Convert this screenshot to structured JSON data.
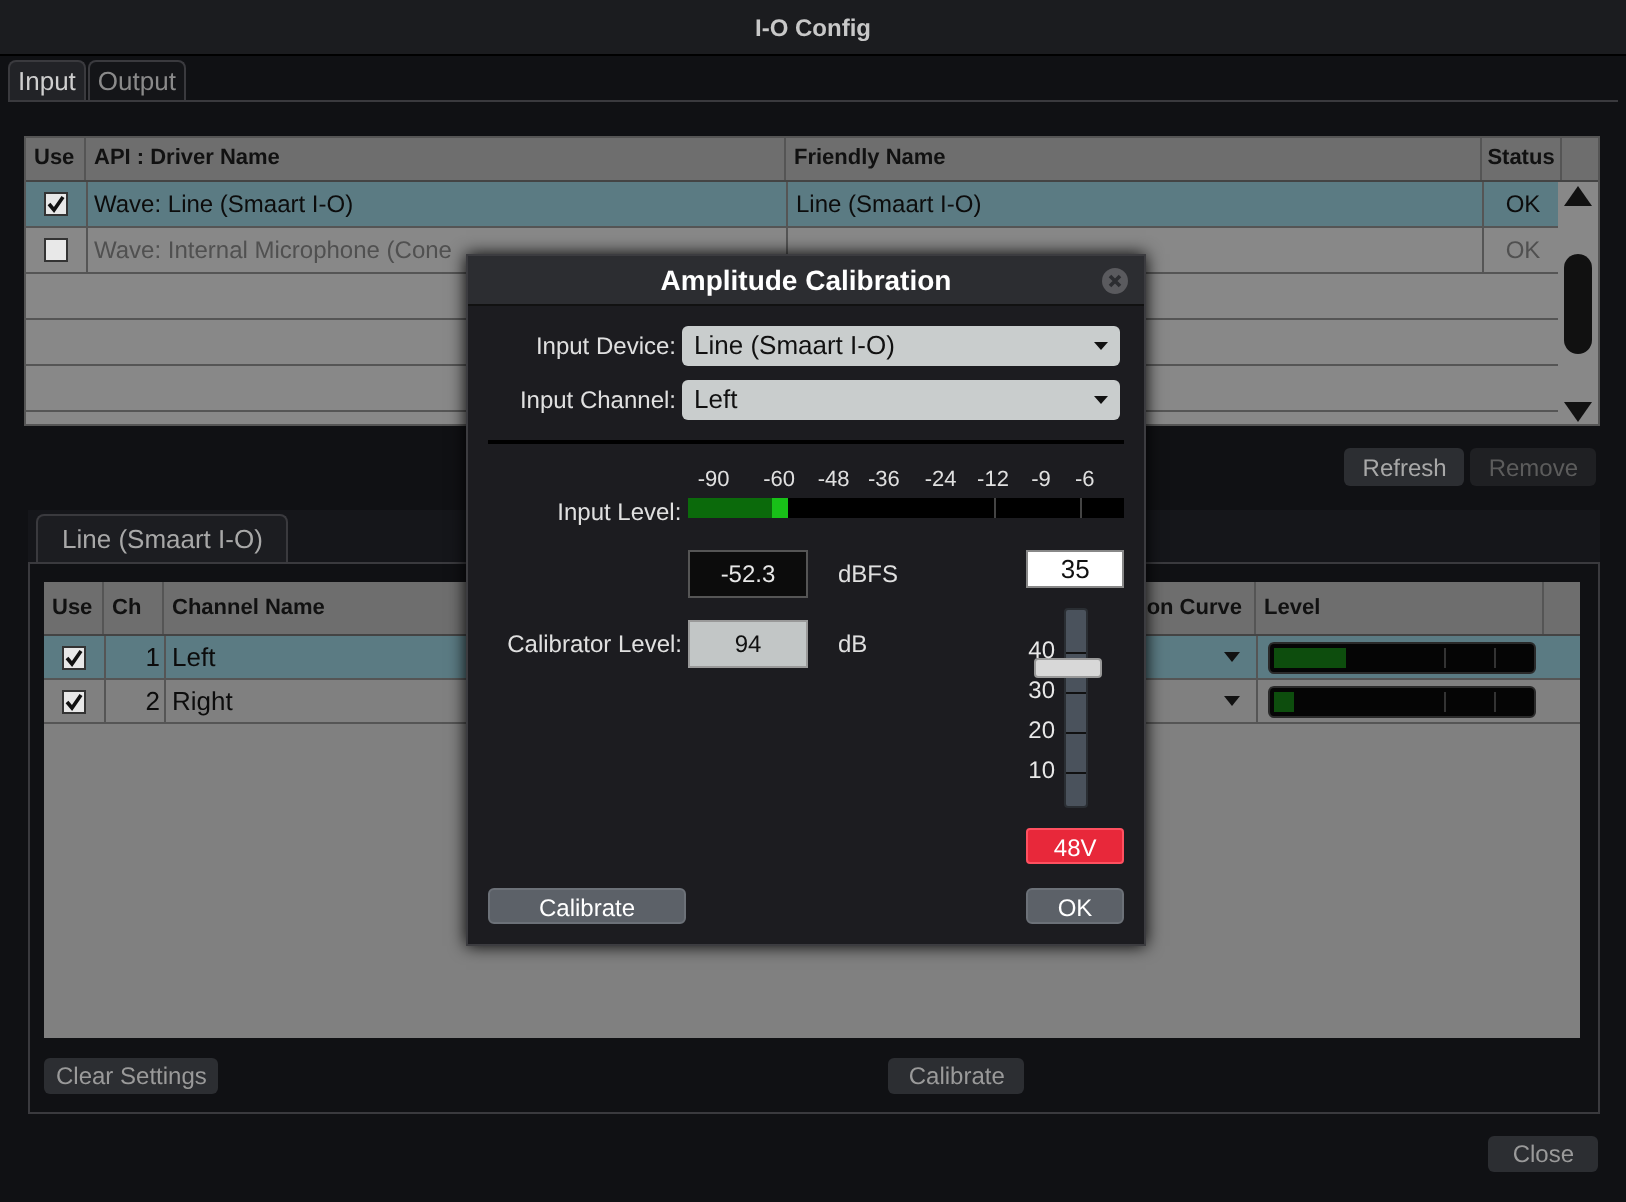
{
  "window": {
    "title": "I-O Config"
  },
  "tabs": [
    {
      "label": "Input",
      "selected": true
    },
    {
      "label": "Output",
      "selected": false
    }
  ],
  "devices": {
    "columns": [
      "Use",
      "API : Driver Name",
      "Friendly Name",
      "Status"
    ],
    "rows": [
      {
        "checked": true,
        "selected": true,
        "disabled": false,
        "driver": "Wave: Line (Smaart I-O)",
        "friendly": "Line (Smaart I-O)",
        "status": "OK"
      },
      {
        "checked": false,
        "selected": false,
        "disabled": true,
        "driver": "Wave: Internal Microphone (Cone",
        "status": "OK"
      }
    ]
  },
  "device_buttons": [
    {
      "label": "Refresh",
      "disabled": false
    },
    {
      "label": "Remove",
      "disabled": true
    }
  ],
  "device_tab": {
    "label": "Line (Smaart I-O)"
  },
  "channels": {
    "columns": [
      "Use",
      "Ch",
      "Channel Name",
      "on Curve",
      "Level"
    ],
    "rows": [
      {
        "checked": true,
        "selected": true,
        "ch": "1",
        "name": "Left",
        "level": 0.28
      },
      {
        "checked": true,
        "selected": false,
        "ch": "2",
        "name": "Right",
        "level": 0.08
      }
    ]
  },
  "panel_buttons": [
    {
      "label": "Clear Settings"
    },
    {
      "label": "Calibrate"
    }
  ],
  "close_button": {
    "label": "Close"
  },
  "dialog": {
    "title": "Amplitude Calibration",
    "fields": [
      {
        "label": "Input Device:",
        "value": "Line (Smaart I-O)"
      },
      {
        "label": "Input Channel:",
        "value": "Left"
      }
    ],
    "input_level": {
      "label": "Input Level:",
      "scale": [
        "-90",
        "-60",
        "-48",
        "-36",
        "-24",
        "-12",
        "-9",
        "-6"
      ],
      "level": 0.23,
      "reading": "-52.3",
      "unit": "dBFS"
    },
    "calibrator": {
      "label": "Calibrator Level:",
      "value": "94",
      "unit": "dB"
    },
    "gain": {
      "value": "35",
      "level": 0.7,
      "ticks": [
        "40",
        "30",
        "20",
        "10"
      ]
    },
    "phantom": {
      "label": "48V",
      "on": true
    },
    "buttons": [
      {
        "label": "Calibrate"
      },
      {
        "label": "OK"
      }
    ]
  }
}
